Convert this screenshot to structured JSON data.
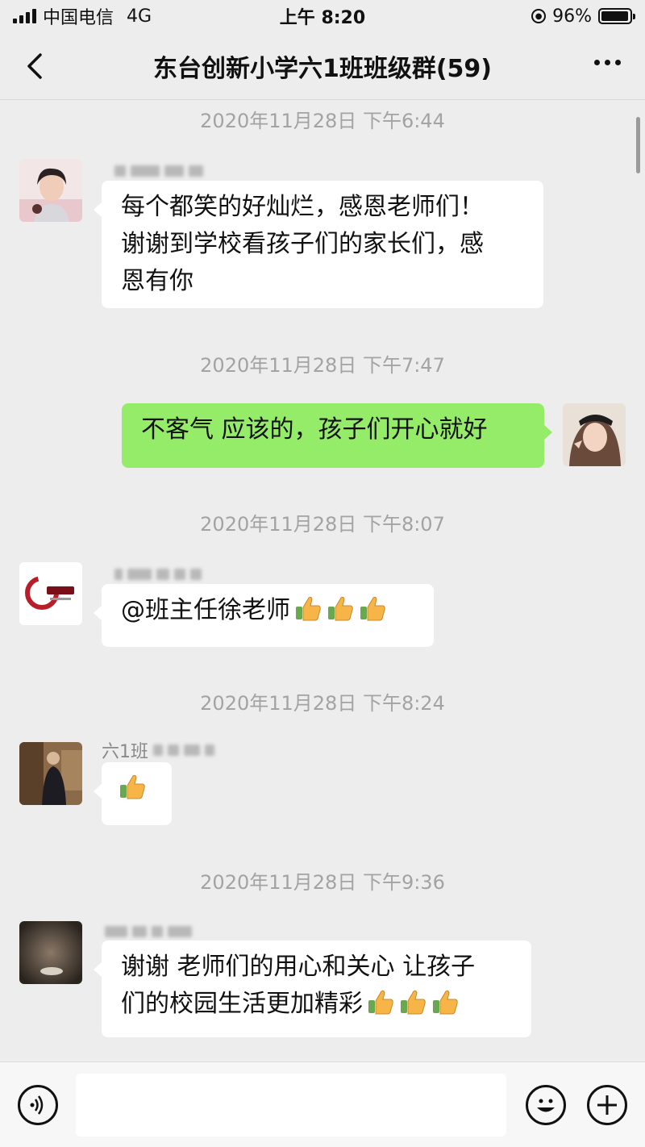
{
  "status_bar": {
    "carrier": "中国电信",
    "network": "4G",
    "time": "上午 8:20",
    "battery": "96%",
    "battery_level": 0.96
  },
  "header": {
    "title": "东台创新小学六1班班级群(59)"
  },
  "messages": [
    {
      "timestamp": "2020年11月28日 下午6:44",
      "side": "left",
      "text_lines": [
        "每个都笑的好灿烂，感恩老师们！",
        "谢谢到学校看孩子们的家长们，感",
        "恩有你"
      ],
      "thumbs": 0
    },
    {
      "timestamp": "2020年11月28日 下午7:47",
      "side": "right",
      "text_lines": [
        "不客气 应该的，孩子们开心就好"
      ],
      "thumbs": 0
    },
    {
      "timestamp": "2020年11月28日 下午8:07",
      "side": "left",
      "text_lines": [
        "@班主任徐老师"
      ],
      "thumbs": 3
    },
    {
      "timestamp": "2020年11月28日 下午8:24",
      "side": "left",
      "sender_partial": "六1班",
      "text_lines": [
        ""
      ],
      "thumbs": 1
    },
    {
      "timestamp": "2020年11月28日 下午9:36",
      "side": "left",
      "text_lines": [
        "谢谢 老师们的用心和关心 让孩子",
        "们的校园生活更加精彩"
      ],
      "thumbs": 3
    }
  ],
  "icons": {
    "back": "chevron-left-icon",
    "more": "more-icon",
    "voice": "voice-icon",
    "emoji": "emoji-icon",
    "plus": "plus-icon",
    "thumb": "thumbs-up-icon"
  },
  "colors": {
    "background": "#ededed",
    "bubble_left": "#ffffff",
    "bubble_right": "#95ec69",
    "timestamp": "#a3a3a3"
  }
}
